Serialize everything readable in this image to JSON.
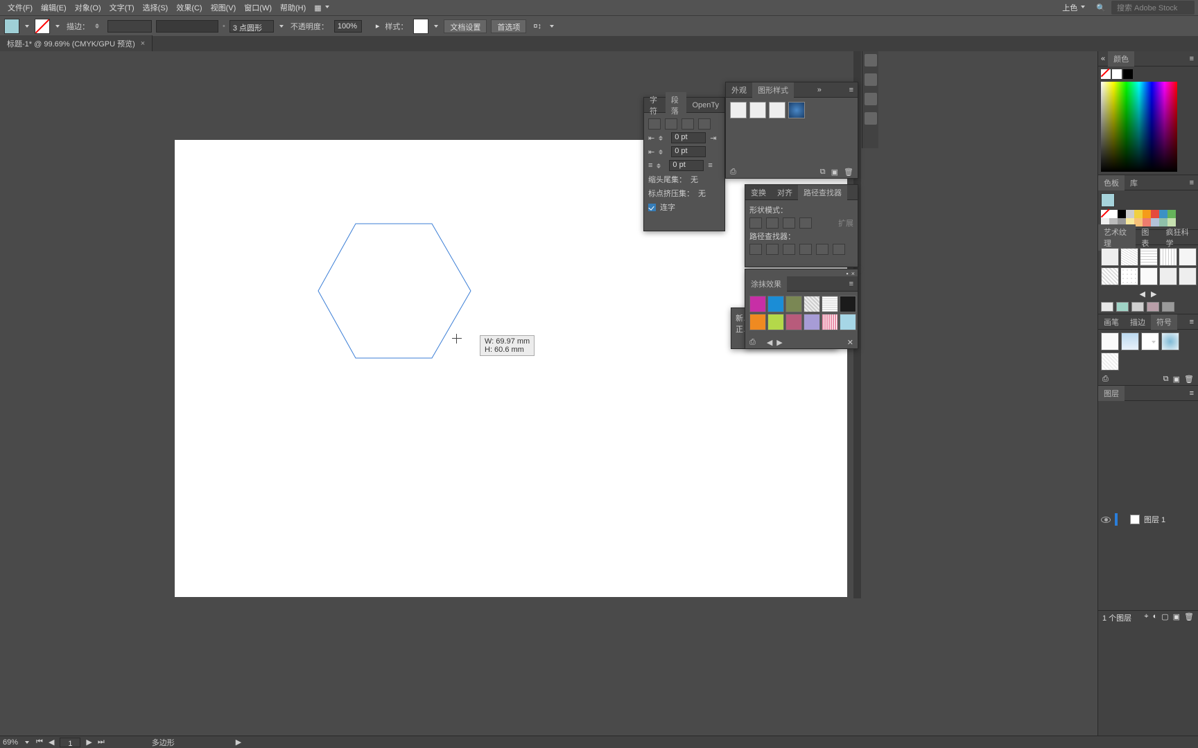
{
  "menubar": {
    "items": [
      "文件(F)",
      "编辑(E)",
      "对象(O)",
      "文字(T)",
      "选择(S)",
      "效果(C)",
      "视图(V)",
      "窗口(W)",
      "帮助(H)"
    ],
    "right_button": "上色",
    "search_placeholder": "搜索 Adobe Stock"
  },
  "controlbar": {
    "stroke_label": "描边：",
    "stroke_weight": "3 点圆形",
    "opacity_label": "不透明度：",
    "opacity_value": "100%",
    "style_label": "样式：",
    "docsetup": "文档设置",
    "prefs": "首选项"
  },
  "tab": {
    "title": "标题-1* @ 99.69% (CMYK/GPU 预览)"
  },
  "measure": {
    "w": "W: 69.97 mm",
    "h": "H: 60.6 mm"
  },
  "paragraph": {
    "tabs": [
      "字符",
      "段落",
      "OpenTy"
    ],
    "active": 1,
    "pt": "0 pt",
    "header_label": "缩头尾集：",
    "header_val": "无",
    "punct_label": "标点挤压集：",
    "punct_val": "无",
    "hyphen_label": "连字"
  },
  "appearance": {
    "tabs": [
      "外观",
      "图形样式"
    ],
    "active": 1
  },
  "color_panel": {
    "tabs": [
      "颜色"
    ],
    "active": 0
  },
  "swatches_panel": {
    "tabs": [
      "色板",
      "库"
    ],
    "active": 0,
    "colors": [
      "#ffffff",
      "#000000",
      "#cccccc",
      "#f0d040",
      "#f59c1a",
      "#e54b3c",
      "#b5a3c7",
      "#3c91c4",
      "#65b35a",
      "#eee",
      "#bbb",
      "#999",
      "#f7e89b",
      "#f6c178",
      "#ed7c6e",
      "#b3c2d9",
      "#8fc0a9",
      "#c6e0b0"
    ]
  },
  "transform_panel": {
    "tabs": [
      "变换",
      "对齐",
      "路径查找器"
    ],
    "active": 2,
    "shape_mode_label": "形状模式：",
    "pathfinder_label": "路径查找器：",
    "expand": "扩展"
  },
  "pattern_panel": {
    "tabs": [
      "艺术纹理",
      "图表",
      "疯狂科学"
    ],
    "active": 0
  },
  "smudge_panel": {
    "tabs": [
      "涂抹效果"
    ],
    "active": 0,
    "colors": [
      "#c72fa6",
      "#1b8dd6",
      "#7a8754",
      "#c9c9c9",
      "#e1e1e1",
      "#1b1b1b",
      "#ef8a21",
      "#b4d84a",
      "#b85b7b",
      "#a79cd6",
      "#e98ea8",
      "#a6d6e6"
    ]
  },
  "brush_panel": {
    "tabs": [
      "画笔",
      "描边",
      "符号"
    ],
    "active": 2
  },
  "layers_panel": {
    "tabs": [
      "图层"
    ],
    "active": 0,
    "layer_name": "图层 1",
    "footer": "1 个图层"
  },
  "statusbar": {
    "zoom": "69%",
    "page": "1",
    "tool": "多边形"
  },
  "hidden_panel": {
    "lines": [
      "新…",
      "正…"
    ]
  }
}
